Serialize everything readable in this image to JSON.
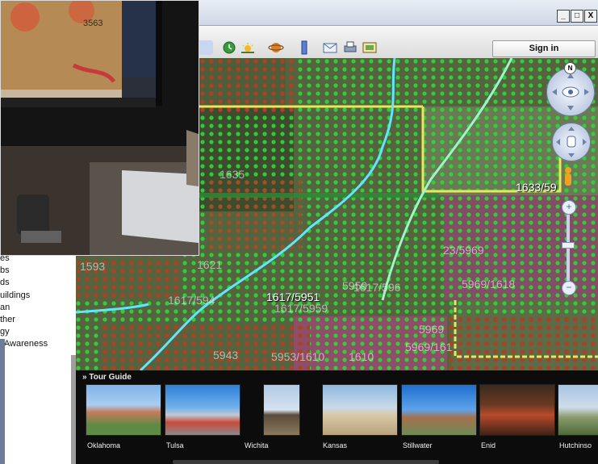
{
  "sidebar": {
    "items": [
      "es",
      "bs",
      "ds",
      "uildings",
      "an",
      "ther",
      "gy",
      "l Awareness"
    ]
  },
  "window": {
    "buttons": [
      "_",
      "□",
      "X"
    ]
  },
  "toolbar": {
    "sign_in_label": "Sign in",
    "icons": [
      "history-icon",
      "sun-icon",
      "planet-icon",
      "ruler-icon",
      "email-icon",
      "print-icon",
      "save-image-icon"
    ]
  },
  "map": {
    "compass_label": "N",
    "labels": [
      "1633/59",
      "1617/5951",
      "1617/5959",
      "1617/596",
      "1617/594",
      "5969/1618",
      "5953/1610",
      "5969/161",
      "5969",
      "1635",
      "1593",
      "1621",
      "23/5969",
      "1610",
      "5959",
      "5943"
    ],
    "accent_colors": {
      "field_green": "#2fd23a",
      "field_red": "#c81f1f",
      "stream": "#5fe7ff",
      "road": "#e8e85a"
    }
  },
  "tour_guide": {
    "title": "Tour Guide",
    "places": [
      "Oklahoma",
      "Tulsa",
      "Wichita",
      "Kansas",
      "Stillwater",
      "Enid",
      "Hutchinso"
    ]
  },
  "camera": {
    "monitor_number": "3563"
  }
}
